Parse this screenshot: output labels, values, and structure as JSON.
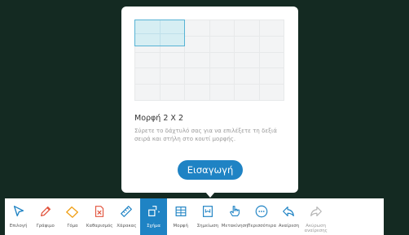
{
  "popup": {
    "shape_title": "Μορφή 2 X 2",
    "hint": "Σύρετε το δάχτυλό σας για να επιλέξετε τη δεξιά σειρά και στήλη στο κουτί μορφής.",
    "insert_label": "Εισαγωγή",
    "grid": {
      "columns": 6,
      "rows": 5,
      "selected_columns": 2,
      "selected_rows": 2
    }
  },
  "toolbar": {
    "items": [
      {
        "label": "Επιλογή",
        "icon": "cursor-icon"
      },
      {
        "label": "Γράψιμο",
        "icon": "pen-icon"
      },
      {
        "label": "Γόμα",
        "icon": "eraser-icon"
      },
      {
        "label": "Καθαρισμός",
        "icon": "clear-icon"
      },
      {
        "label": "Χάρακας",
        "icon": "ruler-icon"
      },
      {
        "label": "Σχήμα",
        "icon": "shape-icon"
      },
      {
        "label": "Μορφή",
        "icon": "table-icon"
      },
      {
        "label": "Σημείωση",
        "icon": "note-icon"
      },
      {
        "label": "Μετακίνηση",
        "icon": "hand-icon"
      },
      {
        "label": "Περισσότερα",
        "icon": "more-icon"
      },
      {
        "label": "Αναίρεση",
        "icon": "undo-icon"
      },
      {
        "label": "Ακύρωση αναίρεσης",
        "icon": "redo-icon"
      }
    ]
  },
  "colors": {
    "background": "#142a22",
    "accent": "#1f83c4",
    "orange_icon": "#f0a018",
    "red_icon": "#e2553f"
  }
}
